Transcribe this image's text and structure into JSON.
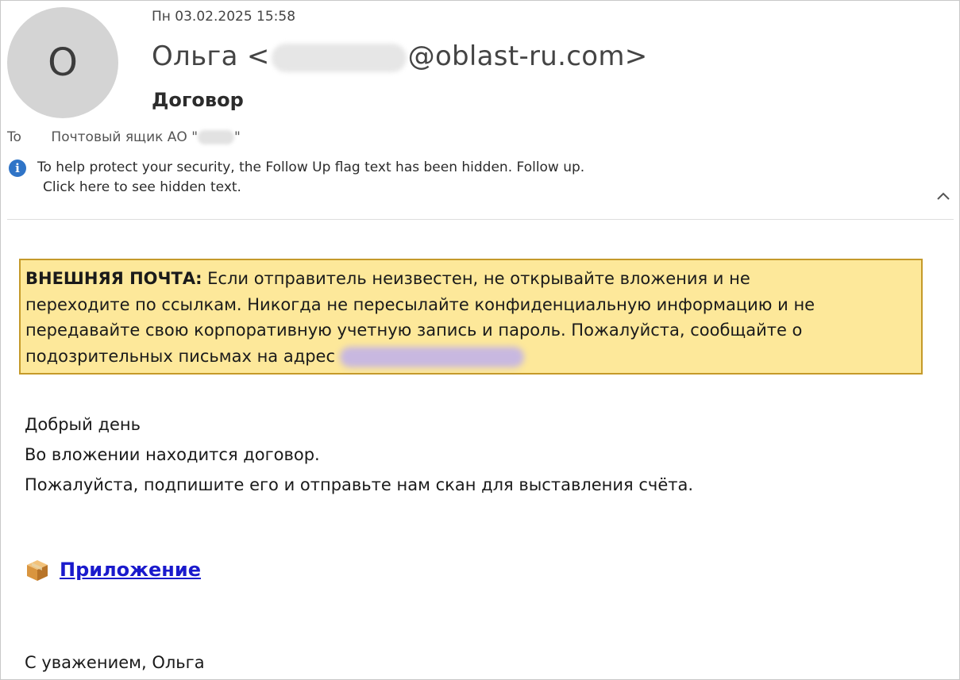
{
  "header": {
    "avatar_letter": "О",
    "date": "Пн 03.02.2025 15:58",
    "sender_name": "Ольга <",
    "sender_domain": "@oblast-ru.com>",
    "subject": "Договор",
    "to_label": "To",
    "to_value": "Почтовый ящик АО \"",
    "to_value_end": "\""
  },
  "infobar": {
    "line1": "To help protect your security, the Follow Up flag text has been hidden. Follow up.",
    "line2": "Click here to see hidden text.",
    "icon": "info-icon"
  },
  "collapse_icon": "chevron-up-icon",
  "warning": {
    "bold_label": "ВНЕШНЯЯ ПОЧТА:",
    "text_line1": " Если отправитель неизвестен, не открывайте вложения и не",
    "text_line2": "переходите по ссылкам. Никогда не пересылайте конфиденциальную информацию и не",
    "text_line3": "передавайте свою корпоративную учетную запись и пароль. Пожалуйста, сообщайте о",
    "text_line4": "подозрительных письмах на адрес",
    "background_color": "#fde89a",
    "border_color": "#c59a2a"
  },
  "body": {
    "line1": "Добрый день",
    "line2": "Во вложении находится договор.",
    "line3": "Пожалуйста, подпишите его и отправьте нам скан для выставления счёта."
  },
  "attachment": {
    "icon": "package-icon",
    "link_text": "Приложение",
    "link_color": "#1a1acc"
  },
  "signature": "С уважением, Ольга"
}
